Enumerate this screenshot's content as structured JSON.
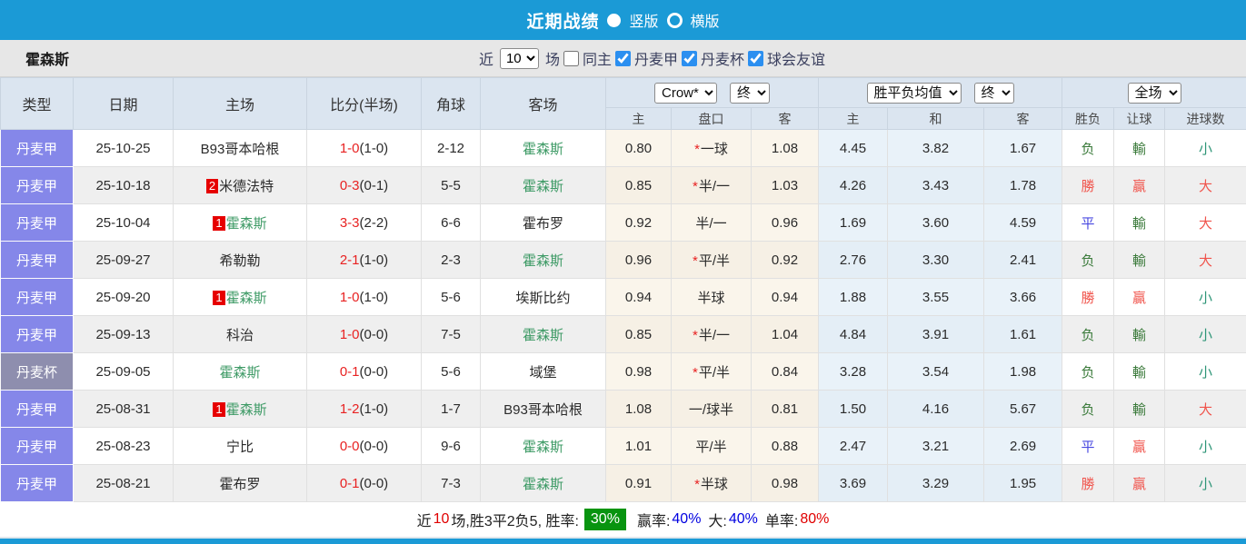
{
  "topbar": {
    "title": "近期战绩",
    "options": [
      {
        "label": "竖版",
        "selected": true
      },
      {
        "label": "横版",
        "selected": false
      }
    ]
  },
  "filterbar": {
    "team": "霍森斯",
    "near_label": "近",
    "count": "10",
    "games_label": "场",
    "same_home_checked": false,
    "same_home_label": "同主",
    "competitions": [
      {
        "label": "丹麦甲",
        "checked": true
      },
      {
        "label": "丹麦杯",
        "checked": true
      },
      {
        "label": "球会友谊",
        "checked": true
      }
    ]
  },
  "table": {
    "headers": [
      "类型",
      "日期",
      "主场",
      "比分(半场)",
      "角球",
      "客场"
    ],
    "selects": {
      "company": "Crow*",
      "company_time": "终",
      "avg": "胜平负均值",
      "avg_time": "终",
      "scope": "全场"
    },
    "sub_headers": [
      "主",
      "盘口",
      "客",
      "主",
      "和",
      "客",
      "胜负",
      "让球",
      "进球数"
    ],
    "rows": [
      {
        "type": "丹麦甲",
        "cup": false,
        "date": "25-10-25",
        "home_rank": "",
        "home": "B93哥本哈根",
        "home_green": false,
        "ft": "1-0",
        "ht": "(1-0)",
        "corner": "2-12",
        "away": "霍森斯",
        "away_green": true,
        "o1": "0.80",
        "star": true,
        "hc": "一球",
        "o2": "1.08",
        "a1": "4.45",
        "a2": "3.82",
        "a3": "1.67",
        "wl": "负",
        "wl_c": "lose",
        "rh": "輸",
        "rh_c": "lose",
        "rg": "小",
        "rg_c": "small"
      },
      {
        "type": "丹麦甲",
        "cup": false,
        "date": "25-10-18",
        "home_rank": "2",
        "home": "米德法特",
        "home_green": false,
        "ft": "0-3",
        "ht": "(0-1)",
        "corner": "5-5",
        "away": "霍森斯",
        "away_green": true,
        "o1": "0.85",
        "star": true,
        "hc": "半/一",
        "o2": "1.03",
        "a1": "4.26",
        "a2": "3.43",
        "a3": "1.78",
        "wl": "勝",
        "wl_c": "win",
        "rh": "贏",
        "rh_c": "win",
        "rg": "大",
        "rg_c": "big"
      },
      {
        "type": "丹麦甲",
        "cup": false,
        "date": "25-10-04",
        "home_rank": "1",
        "home": "霍森斯",
        "home_green": true,
        "ft": "3-3",
        "ht": "(2-2)",
        "corner": "6-6",
        "away": "霍布罗",
        "away_green": false,
        "o1": "0.92",
        "star": false,
        "hc": "半/一",
        "o2": "0.96",
        "a1": "1.69",
        "a2": "3.60",
        "a3": "4.59",
        "wl": "平",
        "wl_c": "draw",
        "rh": "輸",
        "rh_c": "lose",
        "rg": "大",
        "rg_c": "big"
      },
      {
        "type": "丹麦甲",
        "cup": false,
        "date": "25-09-27",
        "home_rank": "",
        "home": "希勒勒",
        "home_green": false,
        "ft": "2-1",
        "ht": "(1-0)",
        "corner": "2-3",
        "away": "霍森斯",
        "away_green": true,
        "o1": "0.96",
        "star": true,
        "hc": "平/半",
        "o2": "0.92",
        "a1": "2.76",
        "a2": "3.30",
        "a3": "2.41",
        "wl": "负",
        "wl_c": "lose",
        "rh": "輸",
        "rh_c": "lose",
        "rg": "大",
        "rg_c": "big"
      },
      {
        "type": "丹麦甲",
        "cup": false,
        "date": "25-09-20",
        "home_rank": "1",
        "home": "霍森斯",
        "home_green": true,
        "ft": "1-0",
        "ht": "(1-0)",
        "corner": "5-6",
        "away": "埃斯比约",
        "away_green": false,
        "o1": "0.94",
        "star": false,
        "hc": "半球",
        "o2": "0.94",
        "a1": "1.88",
        "a2": "3.55",
        "a3": "3.66",
        "wl": "勝",
        "wl_c": "win",
        "rh": "贏",
        "rh_c": "win",
        "rg": "小",
        "rg_c": "small"
      },
      {
        "type": "丹麦甲",
        "cup": false,
        "date": "25-09-13",
        "home_rank": "",
        "home": "科治",
        "home_green": false,
        "ft": "1-0",
        "ht": "(0-0)",
        "corner": "7-5",
        "away": "霍森斯",
        "away_green": true,
        "o1": "0.85",
        "star": true,
        "hc": "半/一",
        "o2": "1.04",
        "a1": "4.84",
        "a2": "3.91",
        "a3": "1.61",
        "wl": "负",
        "wl_c": "lose",
        "rh": "輸",
        "rh_c": "lose",
        "rg": "小",
        "rg_c": "small"
      },
      {
        "type": "丹麦杯",
        "cup": true,
        "date": "25-09-05",
        "home_rank": "",
        "home": "霍森斯",
        "home_green": true,
        "ft": "0-1",
        "ht": "(0-0)",
        "corner": "5-6",
        "away": "域堡",
        "away_green": false,
        "o1": "0.98",
        "star": true,
        "hc": "平/半",
        "o2": "0.84",
        "a1": "3.28",
        "a2": "3.54",
        "a3": "1.98",
        "wl": "负",
        "wl_c": "lose",
        "rh": "輸",
        "rh_c": "lose",
        "rg": "小",
        "rg_c": "small"
      },
      {
        "type": "丹麦甲",
        "cup": false,
        "date": "25-08-31",
        "home_rank": "1",
        "home": "霍森斯",
        "home_green": true,
        "ft": "1-2",
        "ht": "(1-0)",
        "corner": "1-7",
        "away": "B93哥本哈根",
        "away_green": false,
        "o1": "1.08",
        "star": false,
        "hc": "一/球半",
        "o2": "0.81",
        "a1": "1.50",
        "a2": "4.16",
        "a3": "5.67",
        "wl": "负",
        "wl_c": "lose",
        "rh": "輸",
        "rh_c": "lose",
        "rg": "大",
        "rg_c": "big"
      },
      {
        "type": "丹麦甲",
        "cup": false,
        "date": "25-08-23",
        "home_rank": "",
        "home": "宁比",
        "home_green": false,
        "ft": "0-0",
        "ht": "(0-0)",
        "corner": "9-6",
        "away": "霍森斯",
        "away_green": true,
        "o1": "1.01",
        "star": false,
        "hc": "平/半",
        "o2": "0.88",
        "a1": "2.47",
        "a2": "3.21",
        "a3": "2.69",
        "wl": "平",
        "wl_c": "draw",
        "rh": "贏",
        "rh_c": "win",
        "rg": "小",
        "rg_c": "small"
      },
      {
        "type": "丹麦甲",
        "cup": false,
        "date": "25-08-21",
        "home_rank": "",
        "home": "霍布罗",
        "home_green": false,
        "ft": "0-1",
        "ht": "(0-0)",
        "corner": "7-3",
        "away": "霍森斯",
        "away_green": true,
        "o1": "0.91",
        "star": true,
        "hc": "半球",
        "o2": "0.98",
        "a1": "3.69",
        "a2": "3.29",
        "a3": "1.95",
        "wl": "勝",
        "wl_c": "win",
        "rh": "贏",
        "rh_c": "win",
        "rg": "小",
        "rg_c": "small"
      }
    ]
  },
  "summary": {
    "prefix": "近",
    "count": "10",
    "mid": "场,胜3平2负5, 胜率:",
    "win_rate": "30%",
    "seg2": "赢率:",
    "win_pct": "40%",
    "seg3": "大:",
    "big_pct": "40%",
    "seg4": "单率:",
    "single_pct": "80%"
  },
  "colors": {
    "topbar_blue": "#1b9ad6",
    "header_bg": "#dbe5f0",
    "type_league_bg": "#8587e9",
    "type_cup_bg": "#8e8eae",
    "odds_bg": "#faf5eb",
    "avg_bg": "#e9f2f9",
    "team_green": "#3d9a65",
    "score_red": "#e82222",
    "win_red": "#f0544c",
    "lose_green": "#3a7a3a",
    "draw_blue": "#4848e0",
    "small_teal": "#2e9577",
    "rate_badge_green": "#089410",
    "pct_blue": "#0000e0",
    "pct_red": "#e00000"
  }
}
